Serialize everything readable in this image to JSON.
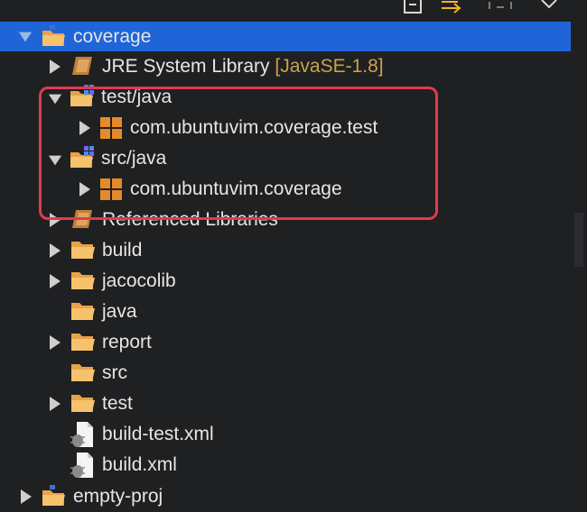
{
  "colors": {
    "background": "#1f2022",
    "selection": "#1f65d8",
    "text": "#e6e6e6",
    "decoration": "#c9a24c",
    "folder": "#e8a247",
    "package": "#e58a2a",
    "highlight": "#e03b50"
  },
  "toolbar": {
    "icons": [
      "collapse-all-icon",
      "link-with-editor-icon",
      "focus-icon",
      "view-menu-icon"
    ]
  },
  "tree": {
    "project": {
      "label": "coverage"
    },
    "jre": {
      "label": "JRE System Library",
      "decoration": "[JavaSE-1.8]"
    },
    "test_java": {
      "label": "test/java"
    },
    "test_pkg": {
      "label": "com.ubuntuvim.coverage.test"
    },
    "src_java": {
      "label": "src/java"
    },
    "src_pkg": {
      "label": "com.ubuntuvim.coverage"
    },
    "ref_libs": {
      "label": "Referenced Libraries"
    },
    "build": {
      "label": "build"
    },
    "jacocolib": {
      "label": "jacocolib"
    },
    "java": {
      "label": "java"
    },
    "report": {
      "label": "report"
    },
    "src": {
      "label": "src"
    },
    "test": {
      "label": "test"
    },
    "build_test_xml": {
      "label": "build-test.xml"
    },
    "build_xml": {
      "label": "build.xml"
    },
    "empty_proj": {
      "label": "empty-proj"
    }
  }
}
